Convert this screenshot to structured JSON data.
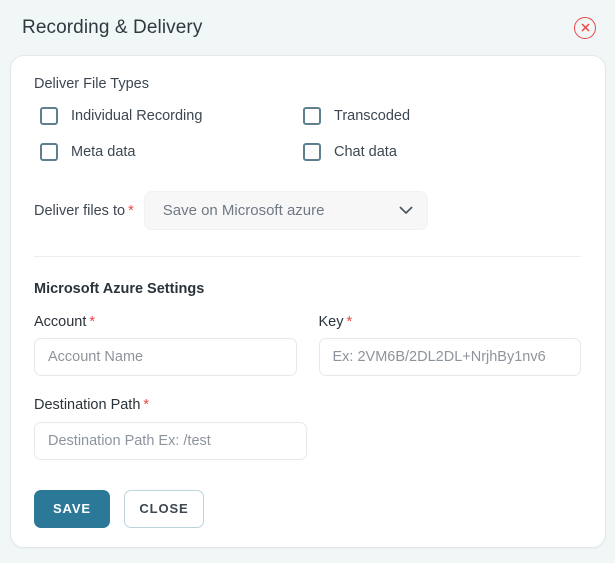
{
  "header": {
    "title": "Recording & Delivery",
    "close_icon": "close-circle-icon"
  },
  "card": {
    "file_types": {
      "label": "Deliver File Types",
      "options": [
        {
          "label": "Individual Recording",
          "checked": false
        },
        {
          "label": "Transcoded",
          "checked": false
        },
        {
          "label": "Meta data",
          "checked": false
        },
        {
          "label": "Chat data",
          "checked": false
        }
      ]
    },
    "deliver_to": {
      "label": "Deliver files to",
      "required_marker": "*",
      "selected": "Save on Microsoft azure",
      "chevron_icon": "chevron-down-icon"
    },
    "azure": {
      "heading": "Microsoft Azure Settings",
      "account": {
        "label": "Account",
        "required_marker": "*",
        "value": "",
        "placeholder": "Account Name"
      },
      "key": {
        "label": "Key",
        "required_marker": "*",
        "value": "",
        "placeholder": "Ex: 2VM6B/2DL2DL+NrjhBy1nv6"
      },
      "destination": {
        "label": "Destination Path",
        "required_marker": "*",
        "value": "",
        "placeholder": "Destination Path Ex: /test"
      }
    },
    "actions": {
      "save_label": "SAVE",
      "close_label": "CLOSE"
    }
  },
  "colors": {
    "page_background": "#f1f7f7",
    "card_background": "#ffffff",
    "accent": "#2b7899",
    "required": "#ef4444",
    "close_icon": "#ef4444",
    "checkbox_border": "#5f7e8e"
  }
}
